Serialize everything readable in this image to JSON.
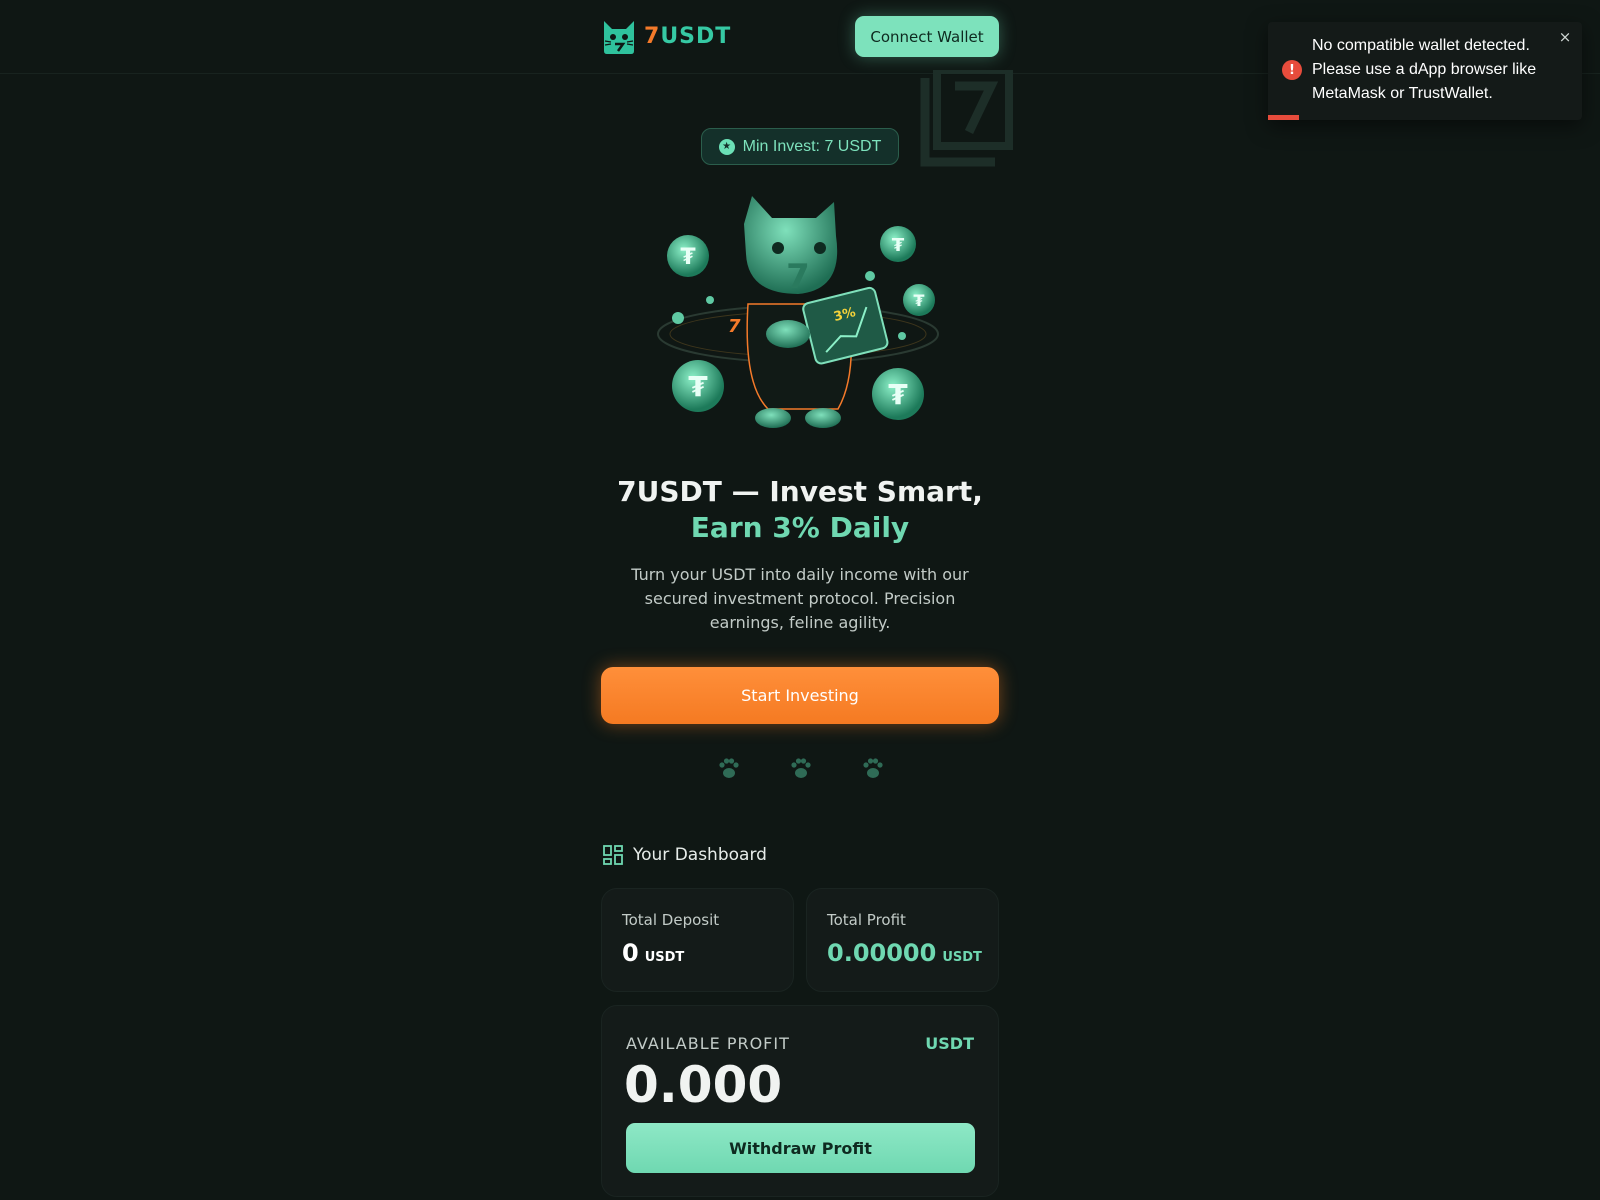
{
  "header": {
    "logo_prefix": "7",
    "logo_suffix": "USDT",
    "connect_label": "Connect Wallet"
  },
  "toast": {
    "message": "No compatible wallet detected. Please use a dApp browser like MetaMask or TrustWallet.",
    "icon": "!",
    "close": "×",
    "type": "error",
    "progress_remaining": 0.1
  },
  "badge": {
    "text": "Min Invest: 7 USDT",
    "icon": "star-icon"
  },
  "hero": {
    "title_main": "7USDT — Invest Smart, ",
    "title_accent": "Earn 3% Daily",
    "subtitle": "Turn your USDT into daily income with our secured investment protocol. Precision earnings, feline agility.",
    "cta_label": "Start Investing",
    "image_label": "3%",
    "paw_count": 3
  },
  "dashboard": {
    "title": "Your Dashboard",
    "total_deposit": {
      "label": "Total Deposit",
      "value": "0",
      "unit": "USDT"
    },
    "total_profit": {
      "label": "Total Profit",
      "value": "0.00000",
      "unit": "USDT"
    },
    "available_profit": {
      "label": "AVAILABLE PROFIT",
      "unit": "USDT",
      "value": "0.000",
      "withdraw_label": "Withdraw Profit"
    }
  },
  "colors": {
    "background": "#0f1714",
    "accent_green": "#6fd8b1",
    "accent_orange": "#f57a22",
    "error_red": "#e74c3c"
  }
}
